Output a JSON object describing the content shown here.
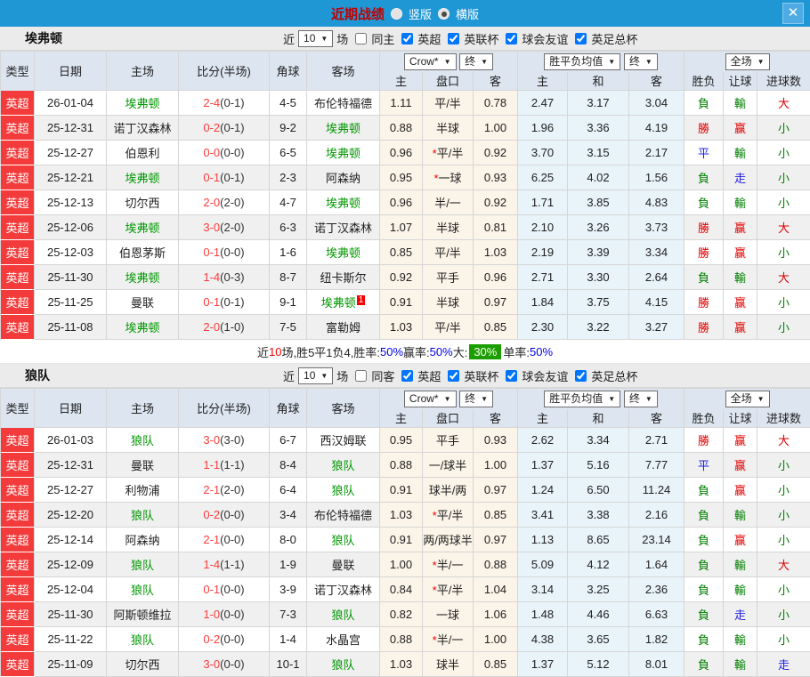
{
  "topbar": {
    "title": "近期战绩",
    "radio_vertical": "竖版",
    "radio_horizontal": "横版",
    "close": "✕"
  },
  "header": {
    "cols": [
      "类型",
      "日期",
      "主场",
      "比分(半场)",
      "角球",
      "客场"
    ],
    "crow": "Crow*",
    "final1": "终",
    "avg": "胜平负均值",
    "final2": "终",
    "full": "全场",
    "sub": [
      "主",
      "盘口",
      "客",
      "主",
      "和",
      "客",
      "胜负",
      "让球",
      "进球数"
    ]
  },
  "colors": {
    "topbar_blue": "#1f97d4",
    "league_red": "#f43b3b",
    "team_green": "#009700",
    "win_red": "#e00000",
    "lose_green": "#008000",
    "draw_blue": "#2020e0",
    "badge_green": "#1c9e00"
  },
  "sections": [
    {
      "team": "埃弗顿",
      "filters": {
        "near": "近",
        "count": "10",
        "games": "场",
        "same": "同主",
        "leagues": [
          "英超",
          "英联杯",
          "球会友谊",
          "英足总杯"
        ]
      },
      "rows": [
        {
          "type": "英超",
          "date": "26-01-04",
          "home": "埃弗顿",
          "hg": true,
          "score": "2-4",
          "half": "(0-1)",
          "corner": "4-5",
          "away": "布伦特福德",
          "ag": false,
          "o1": "1.11",
          "star": false,
          "hcap": "平/半",
          "o2": "0.78",
          "m1": "2.47",
          "m2": "3.17",
          "m3": "3.04",
          "r1": {
            "t": "負",
            "c": "g"
          },
          "r2": {
            "t": "輸",
            "c": "g"
          },
          "r3": {
            "t": "大",
            "c": "r"
          }
        },
        {
          "type": "英超",
          "date": "25-12-31",
          "home": "诺丁汉森林",
          "hg": false,
          "score": "0-2",
          "half": "(0-1)",
          "corner": "9-2",
          "away": "埃弗顿",
          "ag": true,
          "o1": "0.88",
          "star": false,
          "hcap": "半球",
          "o2": "1.00",
          "m1": "1.96",
          "m2": "3.36",
          "m3": "4.19",
          "r1": {
            "t": "勝",
            "c": "r"
          },
          "r2": {
            "t": "赢",
            "c": "r"
          },
          "r3": {
            "t": "小",
            "c": "g"
          }
        },
        {
          "type": "英超",
          "date": "25-12-27",
          "home": "伯恩利",
          "hg": false,
          "score": "0-0",
          "half": "(0-0)",
          "corner": "6-5",
          "away": "埃弗顿",
          "ag": true,
          "o1": "0.96",
          "star": true,
          "hcap": "平/半",
          "o2": "0.92",
          "m1": "3.70",
          "m2": "3.15",
          "m3": "2.17",
          "r1": {
            "t": "平",
            "c": "b"
          },
          "r2": {
            "t": "輸",
            "c": "g"
          },
          "r3": {
            "t": "小",
            "c": "g"
          }
        },
        {
          "type": "英超",
          "date": "25-12-21",
          "home": "埃弗顿",
          "hg": true,
          "score": "0-1",
          "half": "(0-1)",
          "corner": "2-3",
          "away": "阿森纳",
          "ag": false,
          "o1": "0.95",
          "star": true,
          "hcap": "一球",
          "o2": "0.93",
          "m1": "6.25",
          "m2": "4.02",
          "m3": "1.56",
          "r1": {
            "t": "負",
            "c": "g"
          },
          "r2": {
            "t": "走",
            "c": "b"
          },
          "r3": {
            "t": "小",
            "c": "g"
          }
        },
        {
          "type": "英超",
          "date": "25-12-13",
          "home": "切尔西",
          "hg": false,
          "score": "2-0",
          "half": "(2-0)",
          "corner": "4-7",
          "away": "埃弗顿",
          "ag": true,
          "o1": "0.96",
          "star": false,
          "hcap": "半/一",
          "o2": "0.92",
          "m1": "1.71",
          "m2": "3.85",
          "m3": "4.83",
          "r1": {
            "t": "負",
            "c": "g"
          },
          "r2": {
            "t": "輸",
            "c": "g"
          },
          "r3": {
            "t": "小",
            "c": "g"
          }
        },
        {
          "type": "英超",
          "date": "25-12-06",
          "home": "埃弗顿",
          "hg": true,
          "score": "3-0",
          "half": "(2-0)",
          "corner": "6-3",
          "away": "诺丁汉森林",
          "ag": false,
          "o1": "1.07",
          "star": false,
          "hcap": "半球",
          "o2": "0.81",
          "m1": "2.10",
          "m2": "3.26",
          "m3": "3.73",
          "r1": {
            "t": "勝",
            "c": "r"
          },
          "r2": {
            "t": "赢",
            "c": "r"
          },
          "r3": {
            "t": "大",
            "c": "r"
          }
        },
        {
          "type": "英超",
          "date": "25-12-03",
          "home": "伯恩茅斯",
          "hg": false,
          "score": "0-1",
          "half": "(0-0)",
          "corner": "1-6",
          "away": "埃弗顿",
          "ag": true,
          "o1": "0.85",
          "star": false,
          "hcap": "平/半",
          "o2": "1.03",
          "m1": "2.19",
          "m2": "3.39",
          "m3": "3.34",
          "r1": {
            "t": "勝",
            "c": "r"
          },
          "r2": {
            "t": "赢",
            "c": "r"
          },
          "r3": {
            "t": "小",
            "c": "g"
          }
        },
        {
          "type": "英超",
          "date": "25-11-30",
          "home": "埃弗顿",
          "hg": true,
          "score": "1-4",
          "half": "(0-3)",
          "corner": "8-7",
          "away": "纽卡斯尔",
          "ag": false,
          "o1": "0.92",
          "star": false,
          "hcap": "平手",
          "o2": "0.96",
          "m1": "2.71",
          "m2": "3.30",
          "m3": "2.64",
          "r1": {
            "t": "負",
            "c": "g"
          },
          "r2": {
            "t": "輸",
            "c": "g"
          },
          "r3": {
            "t": "大",
            "c": "r"
          }
        },
        {
          "type": "英超",
          "date": "25-11-25",
          "home": "曼联",
          "hg": false,
          "score": "0-1",
          "half": "(0-1)",
          "corner": "9-1",
          "away": "埃弗顿",
          "ag": true,
          "badge": "1",
          "o1": "0.91",
          "star": false,
          "hcap": "半球",
          "o2": "0.97",
          "m1": "1.84",
          "m2": "3.75",
          "m3": "4.15",
          "r1": {
            "t": "勝",
            "c": "r"
          },
          "r2": {
            "t": "赢",
            "c": "r"
          },
          "r3": {
            "t": "小",
            "c": "g"
          }
        },
        {
          "type": "英超",
          "date": "25-11-08",
          "home": "埃弗顿",
          "hg": true,
          "score": "2-0",
          "half": "(1-0)",
          "corner": "7-5",
          "away": "富勒姆",
          "ag": false,
          "o1": "1.03",
          "star": false,
          "hcap": "平/半",
          "o2": "0.85",
          "m1": "2.30",
          "m2": "3.22",
          "m3": "3.27",
          "r1": {
            "t": "勝",
            "c": "r"
          },
          "r2": {
            "t": "赢",
            "c": "r"
          },
          "r3": {
            "t": "小",
            "c": "g"
          }
        }
      ],
      "summary": [
        {
          "t": "近",
          "c": "k"
        },
        {
          "t": "10",
          "c": "r"
        },
        {
          "t": "场,胜5平1负4, ",
          "c": "k"
        },
        {
          "t": "胜率:",
          "c": "k"
        },
        {
          "t": "50%",
          "c": "b"
        },
        {
          "t": " 赢率:",
          "c": "k"
        },
        {
          "t": "50%",
          "c": "b"
        },
        {
          "t": " 大: ",
          "c": "k"
        },
        {
          "t": "30%",
          "c": "badge"
        },
        {
          "t": " 单率:",
          "c": "k"
        },
        {
          "t": "50%",
          "c": "b"
        }
      ]
    },
    {
      "team": "狼队",
      "filters": {
        "near": "近",
        "count": "10",
        "games": "场",
        "same": "同客",
        "leagues": [
          "英超",
          "英联杯",
          "球会友谊",
          "英足总杯"
        ]
      },
      "rows": [
        {
          "type": "英超",
          "date": "26-01-03",
          "home": "狼队",
          "hg": true,
          "score": "3-0",
          "half": "(3-0)",
          "corner": "6-7",
          "away": "西汉姆联",
          "ag": false,
          "o1": "0.95",
          "star": false,
          "hcap": "平手",
          "o2": "0.93",
          "m1": "2.62",
          "m2": "3.34",
          "m3": "2.71",
          "r1": {
            "t": "勝",
            "c": "r"
          },
          "r2": {
            "t": "赢",
            "c": "r"
          },
          "r3": {
            "t": "大",
            "c": "r"
          }
        },
        {
          "type": "英超",
          "date": "25-12-31",
          "home": "曼联",
          "hg": false,
          "score": "1-1",
          "half": "(1-1)",
          "corner": "8-4",
          "away": "狼队",
          "ag": true,
          "o1": "0.88",
          "star": false,
          "hcap": "一/球半",
          "o2": "1.00",
          "m1": "1.37",
          "m2": "5.16",
          "m3": "7.77",
          "r1": {
            "t": "平",
            "c": "b"
          },
          "r2": {
            "t": "赢",
            "c": "r"
          },
          "r3": {
            "t": "小",
            "c": "g"
          }
        },
        {
          "type": "英超",
          "date": "25-12-27",
          "home": "利物浦",
          "hg": false,
          "score": "2-1",
          "half": "(2-0)",
          "corner": "6-4",
          "away": "狼队",
          "ag": true,
          "o1": "0.91",
          "star": false,
          "hcap": "球半/两",
          "o2": "0.97",
          "m1": "1.24",
          "m2": "6.50",
          "m3": "11.24",
          "r1": {
            "t": "負",
            "c": "g"
          },
          "r2": {
            "t": "赢",
            "c": "r"
          },
          "r3": {
            "t": "小",
            "c": "g"
          }
        },
        {
          "type": "英超",
          "date": "25-12-20",
          "home": "狼队",
          "hg": true,
          "score": "0-2",
          "half": "(0-0)",
          "corner": "3-4",
          "away": "布伦特福德",
          "ag": false,
          "o1": "1.03",
          "star": true,
          "hcap": "平/半",
          "o2": "0.85",
          "m1": "3.41",
          "m2": "3.38",
          "m3": "2.16",
          "r1": {
            "t": "負",
            "c": "g"
          },
          "r2": {
            "t": "輸",
            "c": "g"
          },
          "r3": {
            "t": "小",
            "c": "g"
          }
        },
        {
          "type": "英超",
          "date": "25-12-14",
          "home": "阿森纳",
          "hg": false,
          "score": "2-1",
          "half": "(0-0)",
          "corner": "8-0",
          "away": "狼队",
          "ag": true,
          "o1": "0.91",
          "star": false,
          "hcap": "两/两球半",
          "o2": "0.97",
          "m1": "1.13",
          "m2": "8.65",
          "m3": "23.14",
          "r1": {
            "t": "負",
            "c": "g"
          },
          "r2": {
            "t": "赢",
            "c": "r"
          },
          "r3": {
            "t": "小",
            "c": "g"
          }
        },
        {
          "type": "英超",
          "date": "25-12-09",
          "home": "狼队",
          "hg": true,
          "score": "1-4",
          "half": "(1-1)",
          "corner": "1-9",
          "away": "曼联",
          "ag": false,
          "o1": "1.00",
          "star": true,
          "hcap": "半/一",
          "o2": "0.88",
          "m1": "5.09",
          "m2": "4.12",
          "m3": "1.64",
          "r1": {
            "t": "負",
            "c": "g"
          },
          "r2": {
            "t": "輸",
            "c": "g"
          },
          "r3": {
            "t": "大",
            "c": "r"
          }
        },
        {
          "type": "英超",
          "date": "25-12-04",
          "home": "狼队",
          "hg": true,
          "score": "0-1",
          "half": "(0-0)",
          "corner": "3-9",
          "away": "诺丁汉森林",
          "ag": false,
          "o1": "0.84",
          "star": true,
          "hcap": "平/半",
          "o2": "1.04",
          "m1": "3.14",
          "m2": "3.25",
          "m3": "2.36",
          "r1": {
            "t": "負",
            "c": "g"
          },
          "r2": {
            "t": "輸",
            "c": "g"
          },
          "r3": {
            "t": "小",
            "c": "g"
          }
        },
        {
          "type": "英超",
          "date": "25-11-30",
          "home": "阿斯顿维拉",
          "hg": false,
          "score": "1-0",
          "half": "(0-0)",
          "corner": "7-3",
          "away": "狼队",
          "ag": true,
          "o1": "0.82",
          "star": false,
          "hcap": "一球",
          "o2": "1.06",
          "m1": "1.48",
          "m2": "4.46",
          "m3": "6.63",
          "r1": {
            "t": "負",
            "c": "g"
          },
          "r2": {
            "t": "走",
            "c": "b"
          },
          "r3": {
            "t": "小",
            "c": "g"
          }
        },
        {
          "type": "英超",
          "date": "25-11-22",
          "home": "狼队",
          "hg": true,
          "score": "0-2",
          "half": "(0-0)",
          "corner": "1-4",
          "away": "水晶宫",
          "ag": false,
          "o1": "0.88",
          "star": true,
          "hcap": "半/一",
          "o2": "1.00",
          "m1": "4.38",
          "m2": "3.65",
          "m3": "1.82",
          "r1": {
            "t": "負",
            "c": "g"
          },
          "r2": {
            "t": "輸",
            "c": "g"
          },
          "r3": {
            "t": "小",
            "c": "g"
          }
        },
        {
          "type": "英超",
          "date": "25-11-09",
          "home": "切尔西",
          "hg": false,
          "score": "3-0",
          "half": "(0-0)",
          "corner": "10-1",
          "away": "狼队",
          "ag": true,
          "o1": "1.03",
          "star": false,
          "hcap": "球半",
          "o2": "0.85",
          "m1": "1.37",
          "m2": "5.12",
          "m3": "8.01",
          "r1": {
            "t": "負",
            "c": "g"
          },
          "r2": {
            "t": "輸",
            "c": "g"
          },
          "r3": {
            "t": "走",
            "c": "b"
          }
        }
      ],
      "summary": null
    }
  ]
}
